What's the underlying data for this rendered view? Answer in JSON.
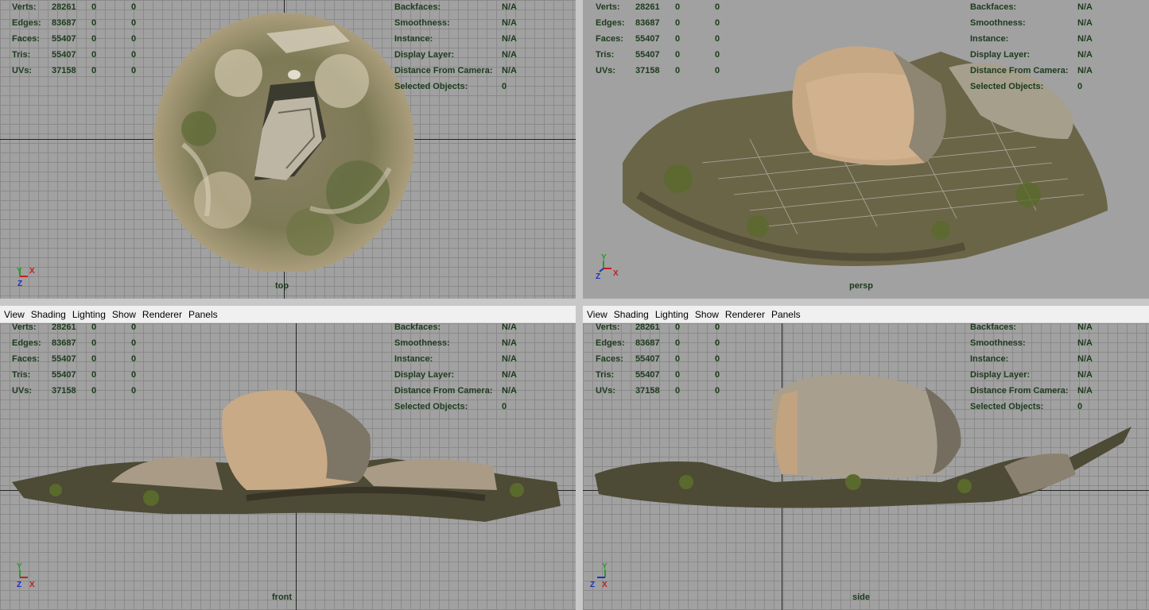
{
  "menu": [
    "View",
    "Shading",
    "Lighting",
    "Show",
    "Renderer",
    "Panels"
  ],
  "stats": [
    {
      "label": "Verts:",
      "values": [
        "28261",
        "0",
        "0"
      ]
    },
    {
      "label": "Edges:",
      "values": [
        "83687",
        "0",
        "0"
      ]
    },
    {
      "label": "Faces:",
      "values": [
        "55407",
        "0",
        "0"
      ]
    },
    {
      "label": "Tris:",
      "values": [
        "55407",
        "0",
        "0"
      ]
    },
    {
      "label": "UVs:",
      "values": [
        "37158",
        "0",
        "0"
      ]
    }
  ],
  "info": [
    {
      "label": "Backfaces:",
      "value": "N/A"
    },
    {
      "label": "Smoothness:",
      "value": "N/A"
    },
    {
      "label": "Instance:",
      "value": "N/A"
    },
    {
      "label": "Display Layer:",
      "value": "N/A"
    },
    {
      "label": "Distance From Camera:",
      "value": "N/A"
    },
    {
      "label": "Selected Objects:",
      "value": "0"
    }
  ],
  "axes": {
    "x": "X",
    "y": "Y",
    "z": "Z"
  },
  "panels": {
    "top": {
      "camera": "top"
    },
    "persp": {
      "camera": "persp"
    },
    "front": {
      "camera": "front"
    },
    "side": {
      "camera": "side"
    }
  },
  "colors": {
    "hud_text": "#1c3a1c",
    "viewport_bg": "#a1a1a1",
    "grid_line": "#8a8a8a",
    "active_border": "#b7c6da"
  }
}
